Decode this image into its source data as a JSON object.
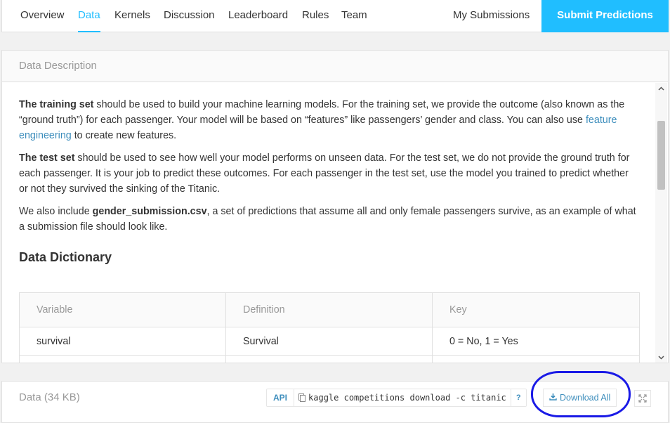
{
  "nav": {
    "tabs": [
      {
        "label": "Overview"
      },
      {
        "label": "Data"
      },
      {
        "label": "Kernels"
      },
      {
        "label": "Discussion"
      },
      {
        "label": "Leaderboard"
      },
      {
        "label": "Rules"
      },
      {
        "label": "Team"
      }
    ],
    "my_submissions": "My Submissions",
    "submit_label": "Submit Predictions",
    "accent": "#20beff"
  },
  "description": {
    "header": "Data Description",
    "p1_bold": "The training set",
    "p1_text": " should be used to build your machine learning models. For the training set, we provide the outcome (also known as the “ground truth”) for each passenger. Your model will be based on “features” like passengers’ gender and class. You can also use ",
    "p1_link": "feature engineering",
    "p1_end": " to create new features.",
    "p2_bold": "The test set",
    "p2_text": " should be used to see how well your model performs on unseen data. For the test set, we do not provide the ground truth for each passenger. It is your job to predict these outcomes. For each passenger in the test set, use the model you trained to predict whether or not they survived the sinking of the Titanic.",
    "p3_start": "We also include ",
    "p3_bold": "gender_submission.csv",
    "p3_text": ", a set of predictions that assume all and only female passengers survive, as an example of what a submission file should look like.",
    "dict_title": "Data Dictionary",
    "table": {
      "headers": [
        "Variable",
        "Definition",
        "Key"
      ],
      "rows": [
        [
          "survival",
          "Survival",
          "0 = No, 1 = Yes"
        ]
      ]
    }
  },
  "data_panel": {
    "title": "Data (34 KB)",
    "api_label": "API",
    "command": "kaggle competitions download -c titanic",
    "help": "?",
    "download_label": "Download All"
  },
  "icons": {
    "copy": "copy-icon",
    "download": "download-icon",
    "expand": "expand-icon",
    "scroll_up": "chevron-up-icon",
    "scroll_down": "chevron-down-icon"
  }
}
